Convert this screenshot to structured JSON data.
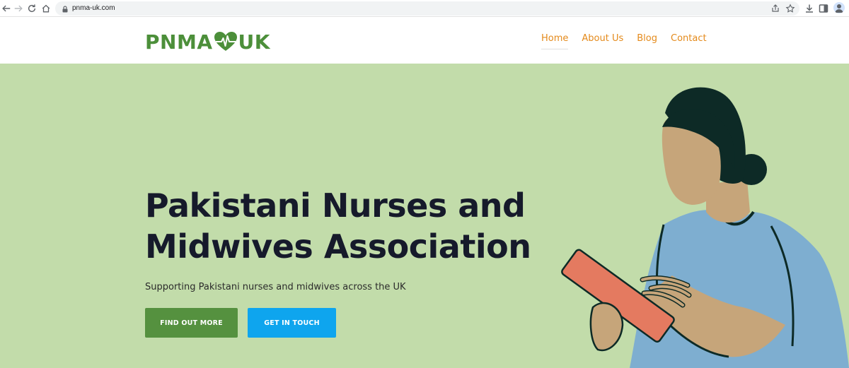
{
  "browser": {
    "url": "pnma-uk.com",
    "icons": [
      "back-icon",
      "forward-icon",
      "reload-icon",
      "home-icon",
      "lock-icon",
      "share-icon",
      "star-icon",
      "download-icon",
      "sidebar-icon",
      "profile-icon"
    ]
  },
  "header": {
    "logo_left": "PNMA",
    "logo_right": "UK",
    "nav": [
      {
        "label": "Home",
        "active": true
      },
      {
        "label": "About Us",
        "active": false
      },
      {
        "label": "Blog",
        "active": false
      },
      {
        "label": "Contact",
        "active": false
      }
    ]
  },
  "hero": {
    "title": "Pakistani Nurses and Midwives Association",
    "subtitle": "Supporting Pakistani nurses and midwives across the UK",
    "primary_button": "FIND OUT MORE",
    "secondary_button": "GET IN TOUCH"
  },
  "colors": {
    "brand_green": "#4c8f3a",
    "nav_orange": "#e48a1b",
    "hero_bg": "#c2dcaa",
    "primary_button": "#55913f",
    "secondary_button": "#0ea5ee",
    "title_text": "#161a2b"
  }
}
